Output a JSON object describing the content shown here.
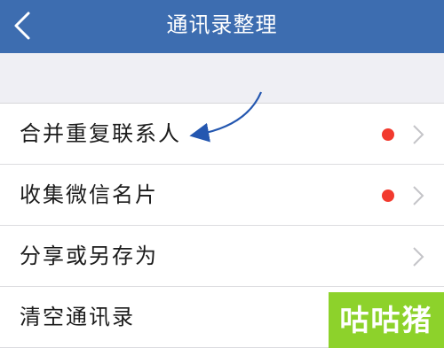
{
  "colors": {
    "nav_bg": "#3d6db0",
    "badge_dot": "#f23a2e",
    "annotation_arrow": "#2457b0",
    "watermark_bg": "#8dd22b"
  },
  "navbar": {
    "back_icon": "chevron-left-icon",
    "title": "通讯录整理"
  },
  "menu": {
    "items": [
      {
        "label": "合并重复联系人",
        "has_dot": true,
        "has_chevron": true
      },
      {
        "label": "收集微信名片",
        "has_dot": true,
        "has_chevron": true
      },
      {
        "label": "分享或另存为",
        "has_dot": false,
        "has_chevron": true
      },
      {
        "label": "清空通讯录",
        "has_dot": false,
        "has_chevron": false
      }
    ]
  },
  "watermark": {
    "text": "咕咕猪"
  }
}
